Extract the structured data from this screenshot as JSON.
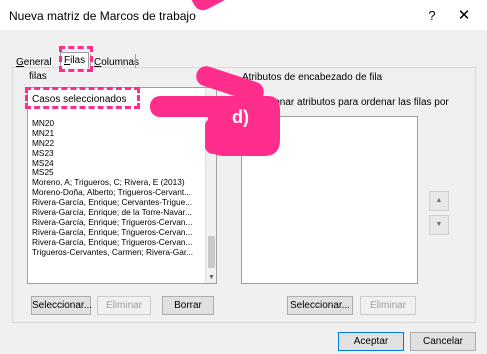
{
  "window": {
    "title": "Nueva matriz de Marcos de trabajo",
    "help": "?",
    "close": "✕"
  },
  "tabs": {
    "general": {
      "prefix": "",
      "accel": "G",
      "rest": "eneral"
    },
    "filas": {
      "prefix": "",
      "accel": "F",
      "rest": "ilas"
    },
    "columnas": {
      "prefix": "",
      "accel": "C",
      "rest": "olumnas"
    }
  },
  "left": {
    "label": "filas",
    "selected": "Casos seleccionados",
    "items": [
      "MN20",
      "MN21",
      "MN22",
      "MS23",
      "MS24",
      "MS25",
      "Moreno, A; Trigueros, C; Rivera, E (2013)",
      "Moreno-Doña, Alberto; Trigueros-Cervant...",
      "Rivera-García, Enrique; Cervantes-Trigue...",
      "Rivera-García, Enrique; de la Torre-Navar...",
      "Rivera-García, Enrique; Trigueros-Cervan...",
      "Rivera-García, Enrique; Trigueros-Cervan...",
      "Rivera-García, Enrique; Trigueros-Cervan...",
      "Trigueros-Cervantes, Carmen; Rivera-Gar..."
    ],
    "buttons": {
      "select": "Seleccionar...",
      "remove": "Eliminar",
      "clear": "Borrar"
    }
  },
  "right": {
    "label": "Atributos de encabezado de fila",
    "hint": "ionar atributos para ordenar las filas por",
    "buttons": {
      "select": "Seleccionar...",
      "remove": "Eliminar"
    },
    "up": "▲",
    "down": "▼"
  },
  "footer": {
    "accept": "Aceptar",
    "cancel": "Cancelar"
  },
  "annotation": {
    "label": "d)"
  },
  "colors": {
    "accent": "#ff2e8c",
    "focus": "#0078d7"
  }
}
